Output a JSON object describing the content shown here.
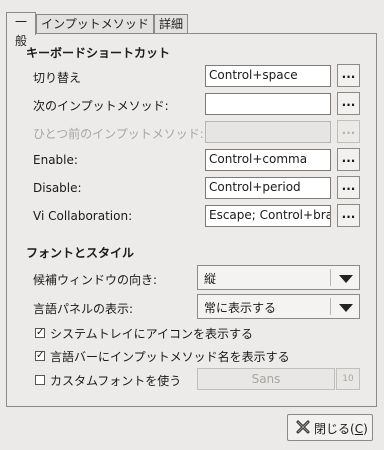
{
  "tabs": [
    "一般",
    "インプットメソッド",
    "詳細"
  ],
  "shortcuts": {
    "title": "キーボードショートカット",
    "rows": [
      {
        "label": "切り替え",
        "value": "Control+space",
        "button": "...",
        "enabled": true
      },
      {
        "label": "次のインプットメソッド:",
        "value": "",
        "button": "...",
        "enabled": true
      },
      {
        "label": "ひとつ前のインプットメソッド:",
        "value": "",
        "button": "...",
        "enabled": false
      },
      {
        "label": "Enable:",
        "value": "Control+comma",
        "button": "...",
        "enabled": true
      },
      {
        "label": "Disable:",
        "value": "Control+period",
        "button": "...",
        "enabled": true
      },
      {
        "label": "Vi Collaboration:",
        "value": "Escape; Control+brac",
        "button": "...",
        "enabled": true
      }
    ]
  },
  "font_style": {
    "title": "フォントとスタイル",
    "candidate_orientation": {
      "label": "候補ウィンドウの向き:",
      "value": "縦"
    },
    "language_panel": {
      "label": "言語パネルの表示:",
      "value": "常に表示する"
    },
    "checkboxes": [
      {
        "label": "システムトレイにアイコンを表示する",
        "checked": true
      },
      {
        "label": "言語バーにインプットメソッド名を表示する",
        "checked": true
      },
      {
        "label": "カスタムフォントを使う",
        "checked": false
      }
    ],
    "font_name": "Sans",
    "font_size": "10"
  },
  "close_button": {
    "label": "閉じる(",
    "mnemonic": "C",
    "suffix": ")"
  }
}
